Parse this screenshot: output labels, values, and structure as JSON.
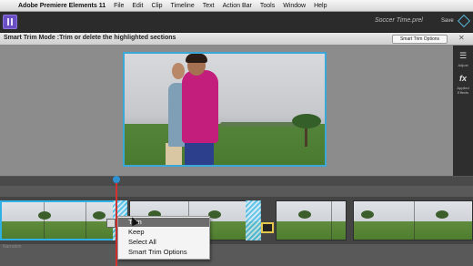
{
  "menubar": {
    "app_name": "Adobe Premiere Elements 11",
    "items": [
      "File",
      "Edit",
      "Clip",
      "Timeline",
      "Text",
      "Action Bar",
      "Tools",
      "Window",
      "Help"
    ]
  },
  "header": {
    "project_name": "Soccer Time.prel",
    "save_label": "Save"
  },
  "smart_trim": {
    "title": "Smart Trim Mode :Trim or delete the highlighted sections",
    "options_button": "Smart Trim Options",
    "close_icon": "close-icon"
  },
  "right_panel": {
    "adjust_label": "Adjust",
    "applied_effects_label": "Applied Effects"
  },
  "timeline": {
    "audio_track_label": "Narration"
  },
  "context_menu": {
    "items": [
      "Trim",
      "Keep",
      "Select All",
      "Smart Trim Options"
    ],
    "highlighted_index": 0
  },
  "colors": {
    "accent": "#2fb1e6",
    "playhead": "#d33030",
    "logo": "#6a4fc4"
  }
}
